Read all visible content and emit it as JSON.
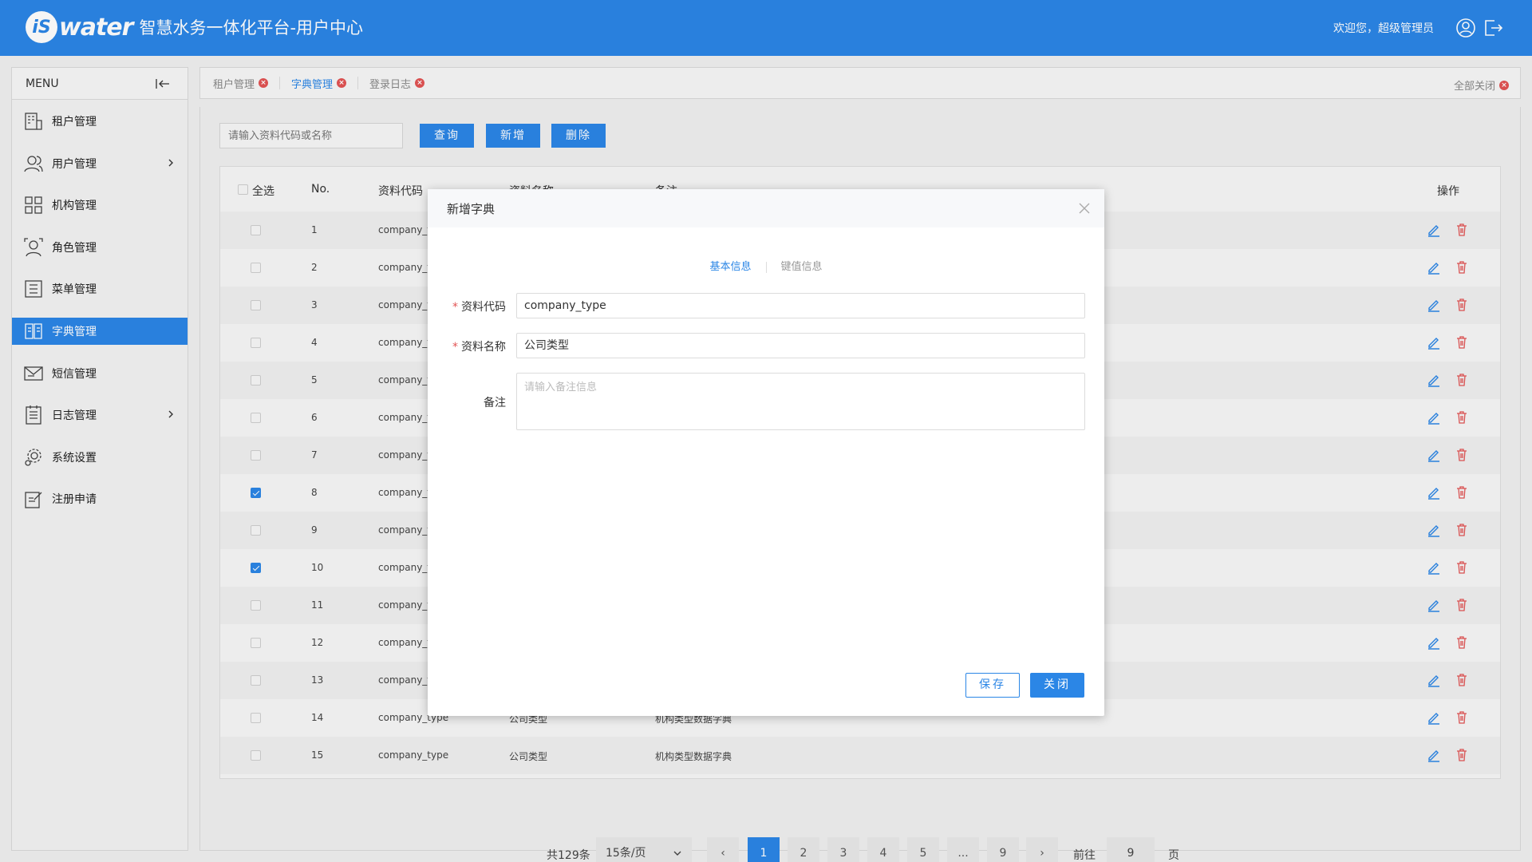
{
  "header": {
    "logo_badge": "iS",
    "logo_word": "water",
    "title": "智慧水务一体化平台-用户中心",
    "welcome": "欢迎您，超级管理员",
    "icons": [
      "user-icon",
      "logout-icon"
    ]
  },
  "sidebar": {
    "menu_label": "MENU",
    "items": [
      {
        "label": "租户管理",
        "icon": "tenant-icon",
        "has_children": false,
        "active": false
      },
      {
        "label": "用户管理",
        "icon": "users-icon",
        "has_children": true,
        "active": false
      },
      {
        "label": "机构管理",
        "icon": "org-icon",
        "has_children": false,
        "active": false
      },
      {
        "label": "角色管理",
        "icon": "role-icon",
        "has_children": false,
        "active": false
      },
      {
        "label": "菜单管理",
        "icon": "menu-icon",
        "has_children": false,
        "active": false
      },
      {
        "label": "字典管理",
        "icon": "dictionary-icon",
        "has_children": false,
        "active": true
      },
      {
        "label": "短信管理",
        "icon": "sms-icon",
        "has_children": false,
        "active": false
      },
      {
        "label": "日志管理",
        "icon": "log-icon",
        "has_children": true,
        "active": false
      },
      {
        "label": "系统设置",
        "icon": "settings-icon",
        "has_children": false,
        "active": false
      },
      {
        "label": "注册申请",
        "icon": "register-icon",
        "has_children": false,
        "active": false
      }
    ]
  },
  "tabs": [
    {
      "label": "租户管理",
      "active": false
    },
    {
      "label": "字典管理",
      "active": true
    },
    {
      "label": "登录日志",
      "active": false
    }
  ],
  "close_all": "全部关闭",
  "toolbar": {
    "search_placeholder": "请输入资料代码或名称",
    "query": "查询",
    "add": "新增",
    "delete": "删除"
  },
  "table": {
    "headers": {
      "select_all": "全选",
      "no": "No.",
      "code": "资料代码",
      "name": "资料名称",
      "remark": "备注",
      "ops": "操作"
    },
    "rows": [
      {
        "no": "1",
        "code": "company_t",
        "name": "",
        "remark": "",
        "checked": false
      },
      {
        "no": "2",
        "code": "company_t",
        "name": "",
        "remark": "",
        "checked": false
      },
      {
        "no": "3",
        "code": "company_t",
        "name": "",
        "remark": "",
        "checked": false
      },
      {
        "no": "4",
        "code": "company_t",
        "name": "",
        "remark": "",
        "checked": false
      },
      {
        "no": "5",
        "code": "company_t",
        "name": "",
        "remark": "",
        "checked": false
      },
      {
        "no": "6",
        "code": "company_t",
        "name": "",
        "remark": "",
        "checked": false
      },
      {
        "no": "7",
        "code": "company_t",
        "name": "",
        "remark": "",
        "checked": false
      },
      {
        "no": "8",
        "code": "company_t",
        "name": "",
        "remark": "",
        "checked": true
      },
      {
        "no": "9",
        "code": "company_t",
        "name": "",
        "remark": "",
        "checked": false
      },
      {
        "no": "10",
        "code": "company_t",
        "name": "",
        "remark": "",
        "checked": true
      },
      {
        "no": "11",
        "code": "company_t",
        "name": "",
        "remark": "",
        "checked": false
      },
      {
        "no": "12",
        "code": "company_t",
        "name": "",
        "remark": "",
        "checked": false
      },
      {
        "no": "13",
        "code": "company_t",
        "name": "",
        "remark": "",
        "checked": false
      },
      {
        "no": "14",
        "code": "company_type",
        "name": "公司类型",
        "remark": "机构类型数据字典",
        "checked": false
      },
      {
        "no": "15",
        "code": "company_type",
        "name": "公司类型",
        "remark": "机构类型数据字典",
        "checked": false
      }
    ]
  },
  "pager": {
    "total": "共129条",
    "page_size": "15条/页",
    "prev": "‹",
    "next": "›",
    "pages": [
      "1",
      "2",
      "3",
      "4",
      "5",
      "...",
      "9"
    ],
    "current": "1",
    "goto_label": "前往",
    "goto_value": "9",
    "unit": "页"
  },
  "modal": {
    "title": "新增字典",
    "tabs": [
      {
        "label": "基本信息",
        "active": true
      },
      {
        "label": "键值信息",
        "active": false
      }
    ],
    "fields": {
      "code_label": "资料代码",
      "code_value": "company_type",
      "name_label": "资料名称",
      "name_value": "公司类型",
      "remark_label": "备注",
      "remark_placeholder": "请输入备注信息"
    },
    "required_mark": "*",
    "save": "保存",
    "close": "关闭"
  },
  "colors": {
    "primary": "#2b86e6",
    "danger": "#e25454"
  }
}
